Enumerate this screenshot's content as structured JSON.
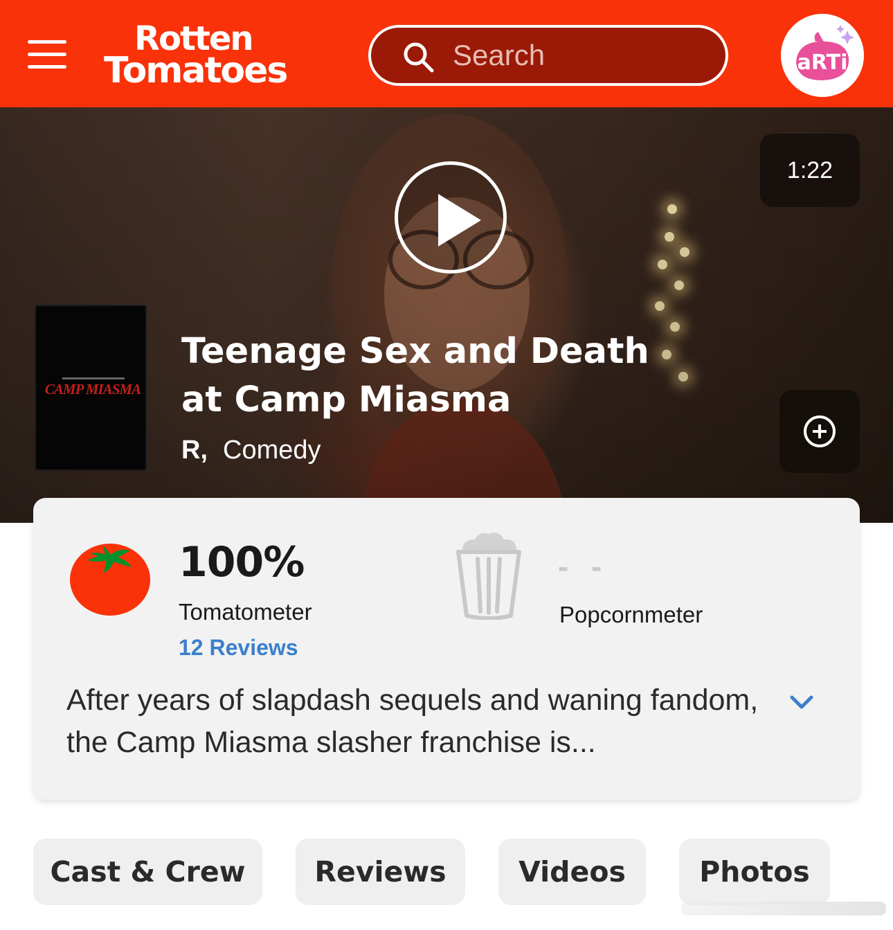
{
  "header": {
    "brand_line1": "Rotten",
    "brand_line2": "Tomatoes",
    "search_placeholder": "Search",
    "avatar_text": "aRTi",
    "brand_color": "#fa320a"
  },
  "trailer": {
    "duration": "1:22"
  },
  "movie": {
    "poster_title": "CAMP MIASMA",
    "title": "Teenage Sex and Death at Camp Miasma",
    "rating": "R,",
    "genre": "Comedy"
  },
  "scores": {
    "tomatometer_value": "100%",
    "tomatometer_label": "Tomatometer",
    "reviews_link": "12 Reviews",
    "popcornmeter_value": "- -",
    "popcornmeter_label": "Popcornmeter"
  },
  "synopsis": "After years of slapdash sequels and waning fandom, the Camp Miasma slasher franchise is...",
  "tabs": [
    {
      "label": "Cast & Crew"
    },
    {
      "label": "Reviews"
    },
    {
      "label": "Videos"
    },
    {
      "label": "Photos"
    }
  ]
}
